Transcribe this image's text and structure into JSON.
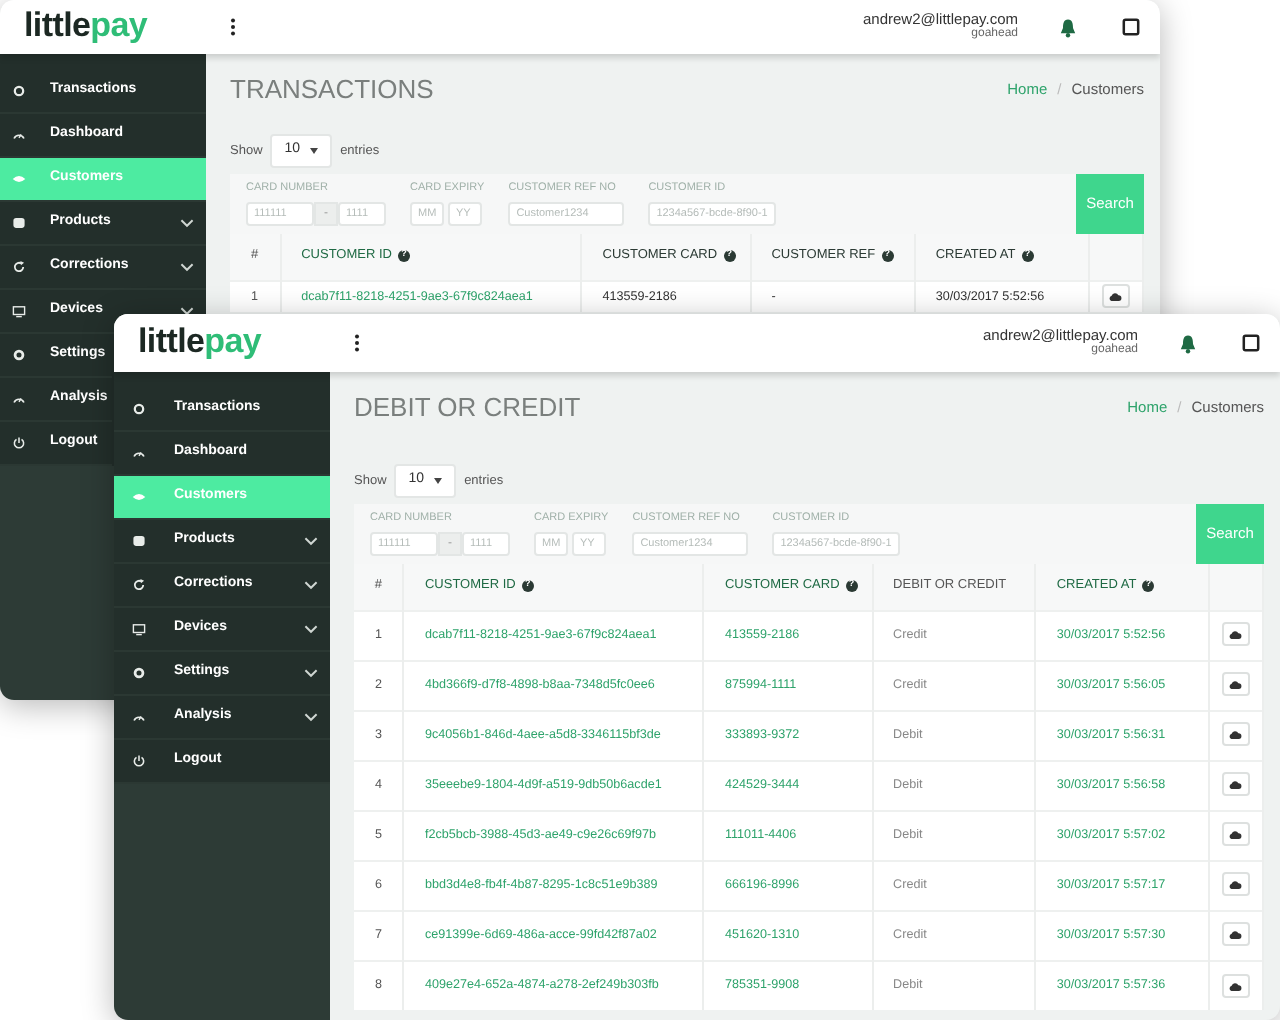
{
  "windows": [
    {
      "header": {
        "logo_dark": "little",
        "logo_accent": "pay",
        "user_email": "andrew2@littlepay.com",
        "user_org": "goahead"
      },
      "sidebar": [
        {
          "label": "Transactions",
          "selected": false,
          "expandable": false
        },
        {
          "label": "Dashboard",
          "selected": false,
          "expandable": false
        },
        {
          "label": "Customers",
          "selected": true,
          "expandable": false
        },
        {
          "label": "Products",
          "selected": false,
          "expandable": true
        },
        {
          "label": "Corrections",
          "selected": false,
          "expandable": true
        },
        {
          "label": "Devices",
          "selected": false,
          "expandable": true
        },
        {
          "label": "Settings",
          "selected": false,
          "expandable": false
        },
        {
          "label": "Analysis",
          "selected": false,
          "expandable": false
        },
        {
          "label": "Logout",
          "selected": false,
          "expandable": false
        }
      ],
      "page_title": "TRANSACTIONS",
      "breadcrumb": [
        {
          "label": "Home",
          "link": true
        },
        {
          "label": "Customers",
          "link": false
        }
      ],
      "breadcrumb_separator": "/",
      "show_label": "Show",
      "entries_value": "10",
      "entries_label": "entries",
      "filters": [
        {
          "label": "CARD NUMBER",
          "separator": "-",
          "fields": [
            {
              "placeholder": "111111"
            },
            {
              "placeholder": "1111"
            }
          ]
        },
        {
          "label": "CARD EXPIRY",
          "fields": [
            {
              "placeholder": "MM"
            },
            {
              "placeholder": "YY"
            }
          ]
        },
        {
          "label": "CUSTOMER REF NO",
          "fields": [
            {
              "placeholder": "Customer1234"
            }
          ]
        },
        {
          "label": "CUSTOMER ID",
          "fields": [
            {
              "placeholder": "1234a567-bcde-8f90-1"
            }
          ]
        }
      ],
      "search_button": "Search",
      "table": {
        "columns": [
          {
            "label": "#",
            "kind": "num"
          },
          {
            "label": "CUSTOMER ID",
            "kind": "link",
            "help": "?"
          },
          {
            "label": "CUSTOMER CARD",
            "kind": "text",
            "help": "?"
          },
          {
            "label": "CUSTOMER REF",
            "kind": "text",
            "help": "?"
          },
          {
            "label": "CREATED AT",
            "kind": "text",
            "help": "?"
          },
          {
            "kind": "action"
          }
        ],
        "rows": [
          [
            "1",
            "dcab7f11-8218-4251-9ae3-67f9c824aea1",
            "413559-2186",
            "-",
            "30/03/2017 5:52:56"
          ]
        ]
      }
    },
    {
      "header": {
        "logo_dark": "little",
        "logo_accent": "pay",
        "user_email": "andrew2@littlepay.com",
        "user_org": "goahead"
      },
      "sidebar": [
        {
          "label": "Transactions",
          "selected": false,
          "expandable": false
        },
        {
          "label": "Dashboard",
          "selected": false,
          "expandable": false
        },
        {
          "label": "Customers",
          "selected": true,
          "expandable": false
        },
        {
          "label": "Products",
          "selected": false,
          "expandable": true
        },
        {
          "label": "Corrections",
          "selected": false,
          "expandable": true
        },
        {
          "label": "Devices",
          "selected": false,
          "expandable": true
        },
        {
          "label": "Settings",
          "selected": false,
          "expandable": true
        },
        {
          "label": "Analysis",
          "selected": false,
          "expandable": true
        },
        {
          "label": "Logout",
          "selected": false,
          "expandable": false
        }
      ],
      "page_title": "DEBIT OR CREDIT",
      "breadcrumb": [
        {
          "label": "Home",
          "link": true
        },
        {
          "label": "Customers",
          "link": false
        }
      ],
      "breadcrumb_separator": "/",
      "show_label": "Show",
      "entries_value": "10",
      "entries_label": "entries",
      "filters": [
        {
          "label": "CARD NUMBER",
          "separator": "-",
          "fields": [
            {
              "placeholder": "111111"
            },
            {
              "placeholder": "1111"
            }
          ]
        },
        {
          "label": "CARD EXPIRY",
          "fields": [
            {
              "placeholder": "MM"
            },
            {
              "placeholder": "YY"
            }
          ]
        },
        {
          "label": "CUSTOMER REF NO",
          "fields": [
            {
              "placeholder": "Customer1234"
            }
          ]
        },
        {
          "label": "CUSTOMER ID",
          "fields": [
            {
              "placeholder": "1234a567-bcde-8f90-1"
            }
          ]
        }
      ],
      "search_button": "Search",
      "table": {
        "columns": [
          {
            "label": "#",
            "kind": "num"
          },
          {
            "label": "CUSTOMER ID",
            "kind": "link",
            "help": "?"
          },
          {
            "label": "CUSTOMER CARD",
            "kind": "link",
            "help": "?"
          },
          {
            "label": "DEBIT OR CREDIT",
            "kind": "muted"
          },
          {
            "label": "CREATED AT",
            "kind": "link",
            "help": "?"
          },
          {
            "kind": "action"
          }
        ],
        "rows": [
          [
            "1",
            "dcab7f11-8218-4251-9ae3-67f9c824aea1",
            "413559-2186",
            "Credit",
            "30/03/2017 5:52:56"
          ],
          [
            "2",
            "4bd366f9-d7f8-4898-b8aa-7348d5fc0ee6",
            "875994-1111",
            "Credit",
            "30/03/2017 5:56:05"
          ],
          [
            "3",
            "9c4056b1-846d-4aee-a5d8-3346115bf3de",
            "333893-9372",
            "Debit",
            "30/03/2017 5:56:31"
          ],
          [
            "4",
            "35eeebe9-1804-4d9f-a519-9db50b6acde1",
            "424529-3444",
            "Debit",
            "30/03/2017 5:56:58"
          ],
          [
            "5",
            "f2cb5bcb-3988-45d3-ae49-c9e26c69f97b",
            "111011-4406",
            "Debit",
            "30/03/2017 5:57:02"
          ],
          [
            "6",
            "bbd3d4e8-fb4f-4b87-8295-1c8c51e9b389",
            "666196-8996",
            "Credit",
            "30/03/2017 5:57:17"
          ],
          [
            "7",
            "ce91399e-6d69-486a-acce-99fd42f87a02",
            "451620-1310",
            "Credit",
            "30/03/2017 5:57:30"
          ],
          [
            "8",
            "409e27e4-652a-4874-a278-2ef249b303fb",
            "785351-9908",
            "Debit",
            "30/03/2017 5:57:36"
          ]
        ]
      }
    }
  ]
}
